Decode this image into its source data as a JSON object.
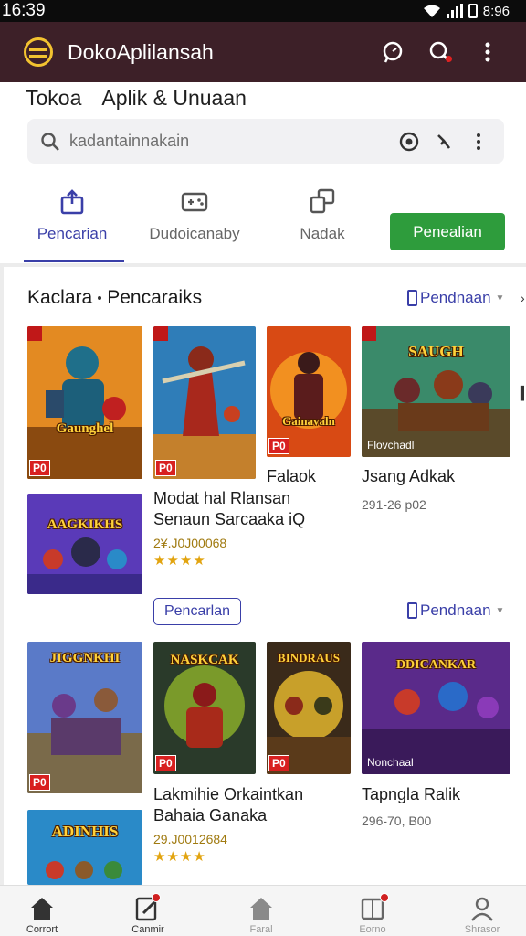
{
  "status": {
    "time": "16:39",
    "battery": "8:96"
  },
  "app": {
    "title": "DokoAplilansah"
  },
  "brand": {
    "left": "Tokoa",
    "right": "Aplik & Unuaan"
  },
  "search": {
    "placeholder": "kadantainnakain"
  },
  "tabs": [
    {
      "label": "Pencarian",
      "icon": "upload-box-icon"
    },
    {
      "label": "Dudoicanaby",
      "icon": "gamepad-icon"
    },
    {
      "label": "Nadak",
      "icon": "copy-windows-icon"
    }
  ],
  "promo_label": "Penealian",
  "section1": {
    "title_a": "Kaclara",
    "title_b": "Pencaraiks",
    "sort_label": "Pendnaan"
  },
  "row1": {
    "tiles": [
      {
        "art": "Gaunghel",
        "badge": "P0"
      },
      {
        "art": "",
        "badge": "P0"
      },
      {
        "art": "Gainavaln",
        "badge": "P0"
      },
      {
        "art": "SAUGH",
        "caption": "Flovchadl"
      }
    ],
    "small_tile": {
      "art": "AAGKIKHS"
    },
    "item_a_top": "Falaok",
    "item_a_title": "Modat hal Rlansan Senaun Sarcaaka iQ",
    "item_a_meta": "2¥.J0J00068",
    "item_a_stars": "★★★★",
    "item_b_title": "Jsang Adkak",
    "item_b_meta": "291-26 p02"
  },
  "section2": {
    "chip": "Pencarlan",
    "sort_label": "Pendnaan"
  },
  "row2": {
    "tiles": [
      {
        "art": "JIGGNKHI",
        "badge": "P0"
      },
      {
        "art": "NASKCAK",
        "badge": "P0"
      },
      {
        "art": "BINDRAUS",
        "badge": "P0"
      },
      {
        "art": "DDICANKAR",
        "caption": "Nonchaal"
      }
    ],
    "small_tile": {
      "art": "ADINHIS"
    },
    "item_a_title": "Lakmihie Orkaintkan Bahaia Ganaka",
    "item_a_meta": "29.J0012684",
    "item_a_stars": "★★★★",
    "item_b_title": "Tapngla Ralik",
    "item_b_meta": "296-70, B00"
  },
  "bottom_nav": [
    {
      "label": "Corrort",
      "icon": "home-icon"
    },
    {
      "label": "Canmir",
      "icon": "edit-icon"
    },
    {
      "label": "Faral",
      "icon": "home-outline-icon"
    },
    {
      "label": "Eorno",
      "icon": "book-icon"
    },
    {
      "label": "Shrasor",
      "icon": "person-icon"
    }
  ]
}
